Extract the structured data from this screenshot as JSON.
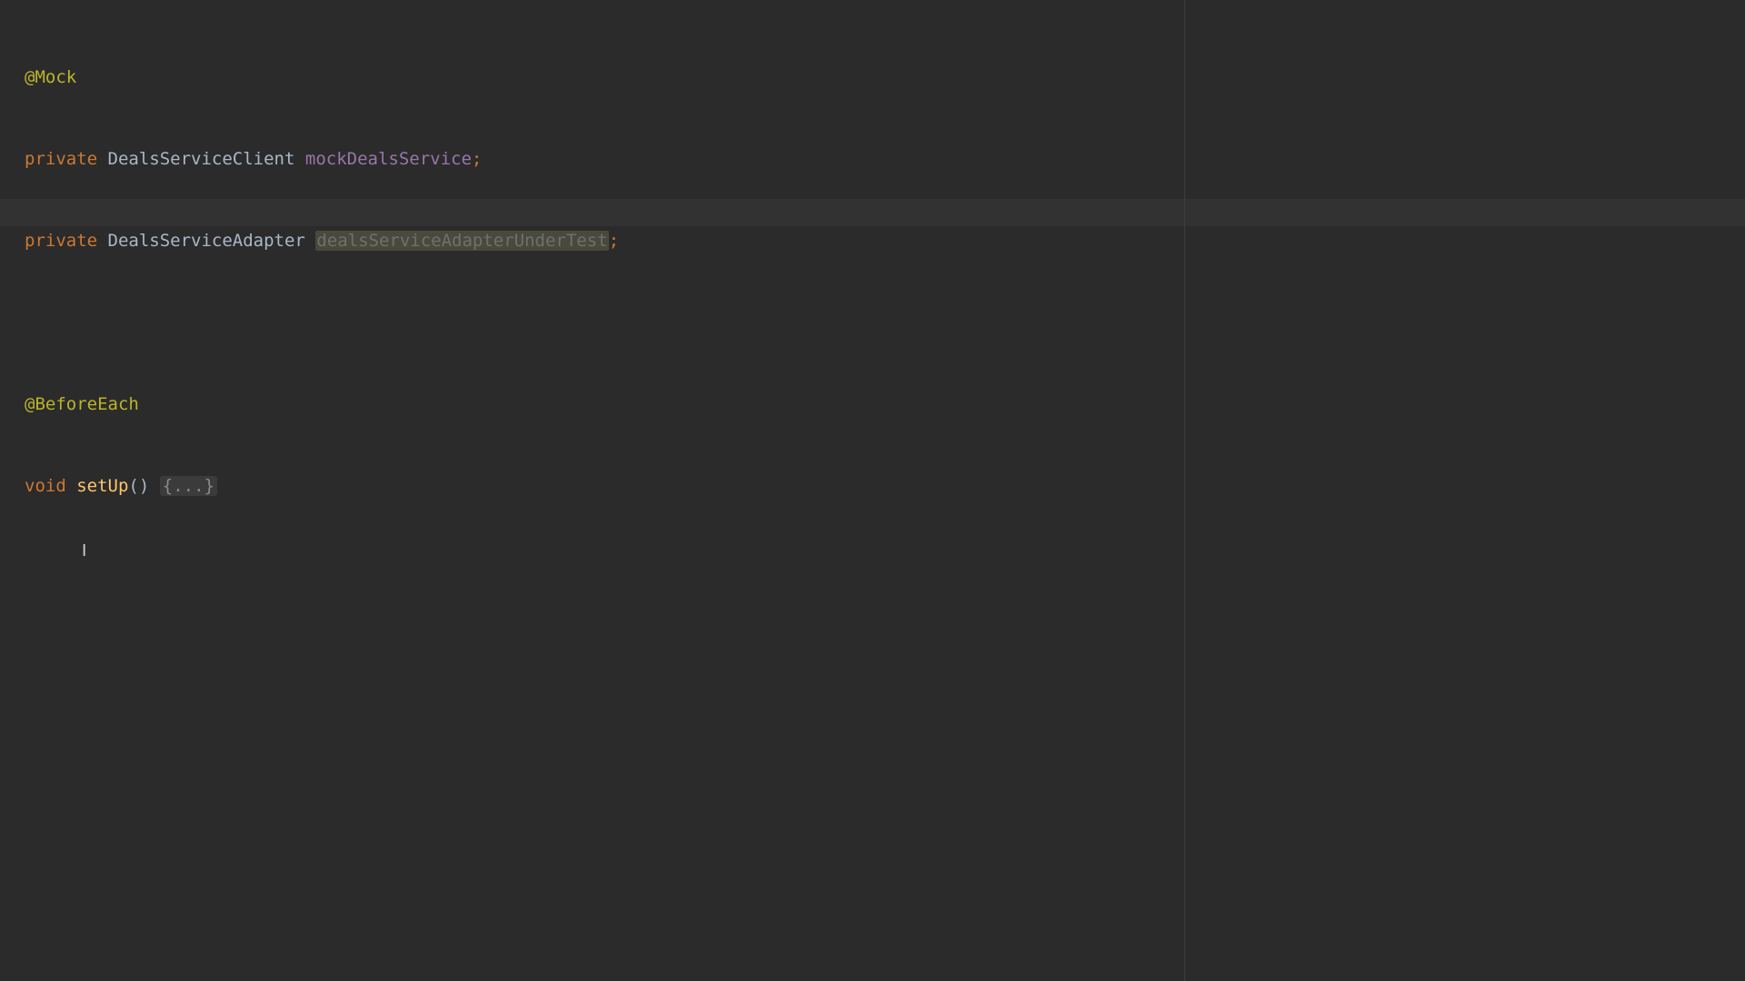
{
  "editor": {
    "lines": [
      {
        "annotation": "@Mock"
      },
      {
        "keyword": "private",
        "type": "DealsServiceClient",
        "name": "mockDealsService",
        "terminator": ";"
      },
      {
        "keyword": "private",
        "type": "DealsServiceAdapter",
        "name": "dealsServiceAdapterUnderTest",
        "terminator": ";"
      },
      {},
      {
        "annotation": "@BeforeEach"
      },
      {
        "keyword": "void",
        "method": "setUp",
        "parens": "()",
        "folded": "{...}"
      }
    ],
    "mouse_cursor_glyph": "I"
  },
  "colors": {
    "background": "#2b2b2b",
    "annotation": "#bbb529",
    "keyword": "#cc7832",
    "field": "#9876aa",
    "method": "#ffc66d",
    "text": "#a9b7c6"
  }
}
